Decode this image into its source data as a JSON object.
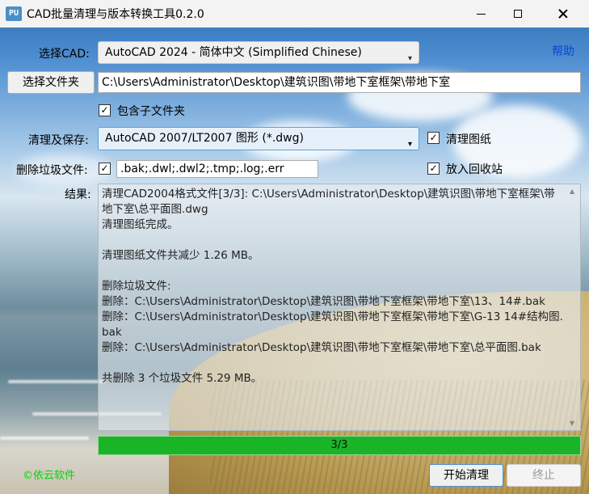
{
  "window": {
    "app_icon_text": "PU",
    "title": "CAD批量清理与版本转换工具0.2.0"
  },
  "cad_select": {
    "label": "选择CAD:",
    "value": "AutoCAD 2024 - 简体中文 (Simplified Chinese)",
    "help_link": "帮助"
  },
  "folder": {
    "button_label": "选择文件夹",
    "path": "C:\\Users\\Administrator\\Desktop\\建筑识图\\带地下室框架\\带地下室",
    "include_subfolders_label": "包含子文件夹",
    "include_subfolders_checked": true
  },
  "save": {
    "label": "清理及保存:",
    "format": "AutoCAD 2007/LT2007 图形 (*.dwg)",
    "clean_drawing_label": "清理图纸",
    "clean_drawing_checked": true
  },
  "junk": {
    "label": "删除垃圾文件:",
    "checked": true,
    "patterns": ".bak;.dwl;.dwl2;.tmp;.log;.err",
    "recycle_label": "放入回收站",
    "recycle_checked": true
  },
  "result": {
    "label": "结果:",
    "lines": [
      "清理CAD2004格式文件[3/3]: C:\\Users\\Administrator\\Desktop\\建筑识图\\带地下室框架\\带地下室\\总平面图.dwg",
      "清理图纸完成。",
      "",
      "清理图纸文件共减少 1.26 MB。",
      "",
      "删除垃圾文件:",
      "删除：C:\\Users\\Administrator\\Desktop\\建筑识图\\带地下室框架\\带地下室\\13、14#.bak",
      "删除：C:\\Users\\Administrator\\Desktop\\建筑识图\\带地下室框架\\带地下室\\G-13 14#结构图.bak",
      "删除：C:\\Users\\Administrator\\Desktop\\建筑识图\\带地下室框架\\带地下室\\总平面图.bak",
      "",
      "共删除 3 个垃圾文件 5.29 MB。"
    ]
  },
  "progress": {
    "text": "3/3",
    "fraction": 1.0,
    "color": "#19b526"
  },
  "footer": {
    "copyright": "©依云软件",
    "start_button": "开始清理",
    "stop_button": "终止"
  },
  "colors": {
    "link": "#0a46d6",
    "copyright": "#0ad10a",
    "titlebar": "#f3f3f3"
  }
}
